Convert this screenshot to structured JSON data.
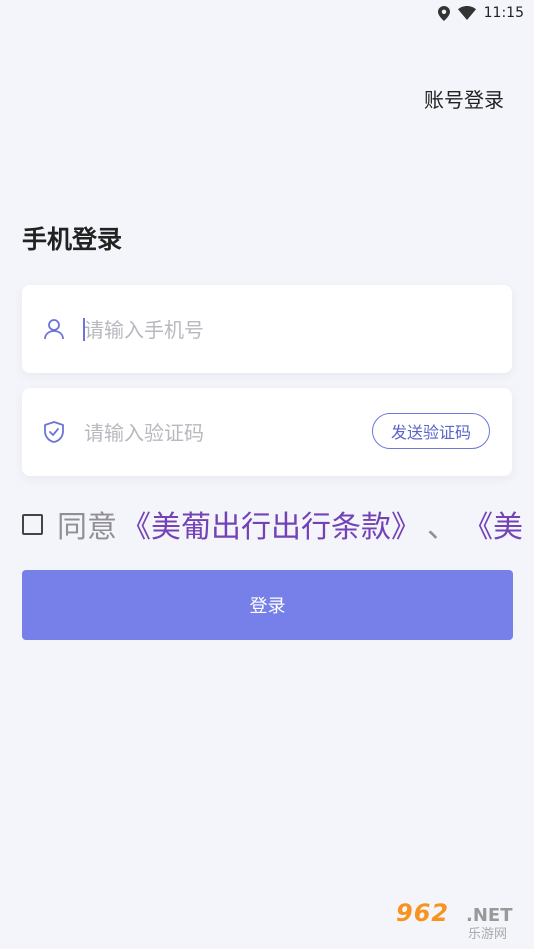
{
  "status_bar": {
    "time": "11:15"
  },
  "header": {
    "account_login": "账号登录"
  },
  "page": {
    "title": "手机登录"
  },
  "phone_field": {
    "placeholder": "请输入手机号"
  },
  "code_field": {
    "placeholder": "请输入验证码",
    "send_button": "发送验证码"
  },
  "agreement": {
    "prefix": "同意",
    "terms_link": "《美葡出行出行条款》",
    "separator": "、",
    "second_link": "《美"
  },
  "login_button": {
    "label": "登录"
  },
  "watermark": {
    "main": "962",
    "net": ".NET",
    "sub": "乐游网"
  },
  "colors": {
    "accent": "#7680e8",
    "link": "#7343b6",
    "background": "#f4f5fa"
  }
}
